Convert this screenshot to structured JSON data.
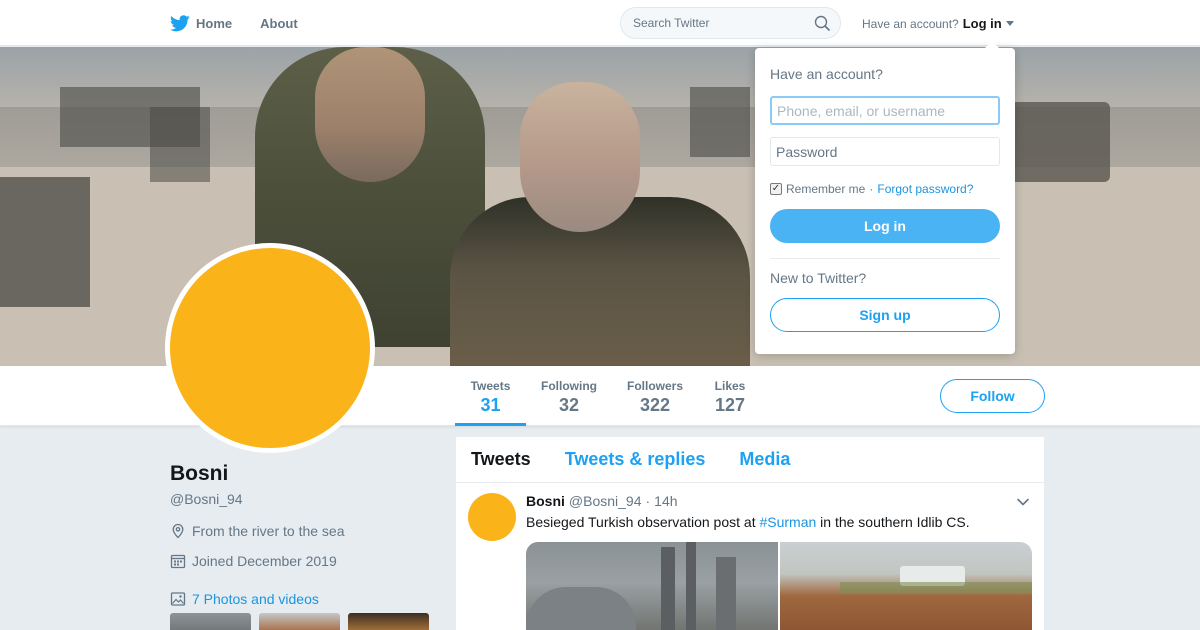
{
  "nav": {
    "home_label": "Home",
    "about_label": "About",
    "search_placeholder": "Search Twitter",
    "account_prompt": "Have an account?",
    "login_label": "Log in"
  },
  "profile": {
    "name": "Bosni",
    "handle": "@Bosni_94",
    "location": "From the river to the sea",
    "joined": "Joined December 2019",
    "photos_link": "7 Photos and videos",
    "avatar_color": "#fbb31a"
  },
  "stats": [
    {
      "label": "Tweets",
      "value": "31",
      "active": true
    },
    {
      "label": "Following",
      "value": "32",
      "active": false
    },
    {
      "label": "Followers",
      "value": "322",
      "active": false
    },
    {
      "label": "Likes",
      "value": "127",
      "active": false
    }
  ],
  "follow_label": "Follow",
  "timeline": {
    "tabs": [
      "Tweets",
      "Tweets & replies",
      "Media"
    ],
    "active_tab": "Tweets",
    "tweet": {
      "name": "Bosni",
      "handle": "@Bosni_94",
      "separator": "·",
      "time": "14h",
      "text_before": "Besieged Turkish observation post at ",
      "hashtag": "#Surman",
      "text_after": " in the southern Idlib CS."
    }
  },
  "login_dropdown": {
    "title": "Have an account?",
    "username_placeholder": "Phone, email, or username",
    "password_placeholder": "Password",
    "remember_label": "Remember me",
    "separator": "·",
    "forgot_label": "Forgot password?",
    "login_button": "Log in",
    "new_prompt": "New to Twitter?",
    "signup_button": "Sign up"
  },
  "colors": {
    "accent": "#1da1f2",
    "link": "#1b95e0",
    "avatar": "#fbb31a"
  }
}
